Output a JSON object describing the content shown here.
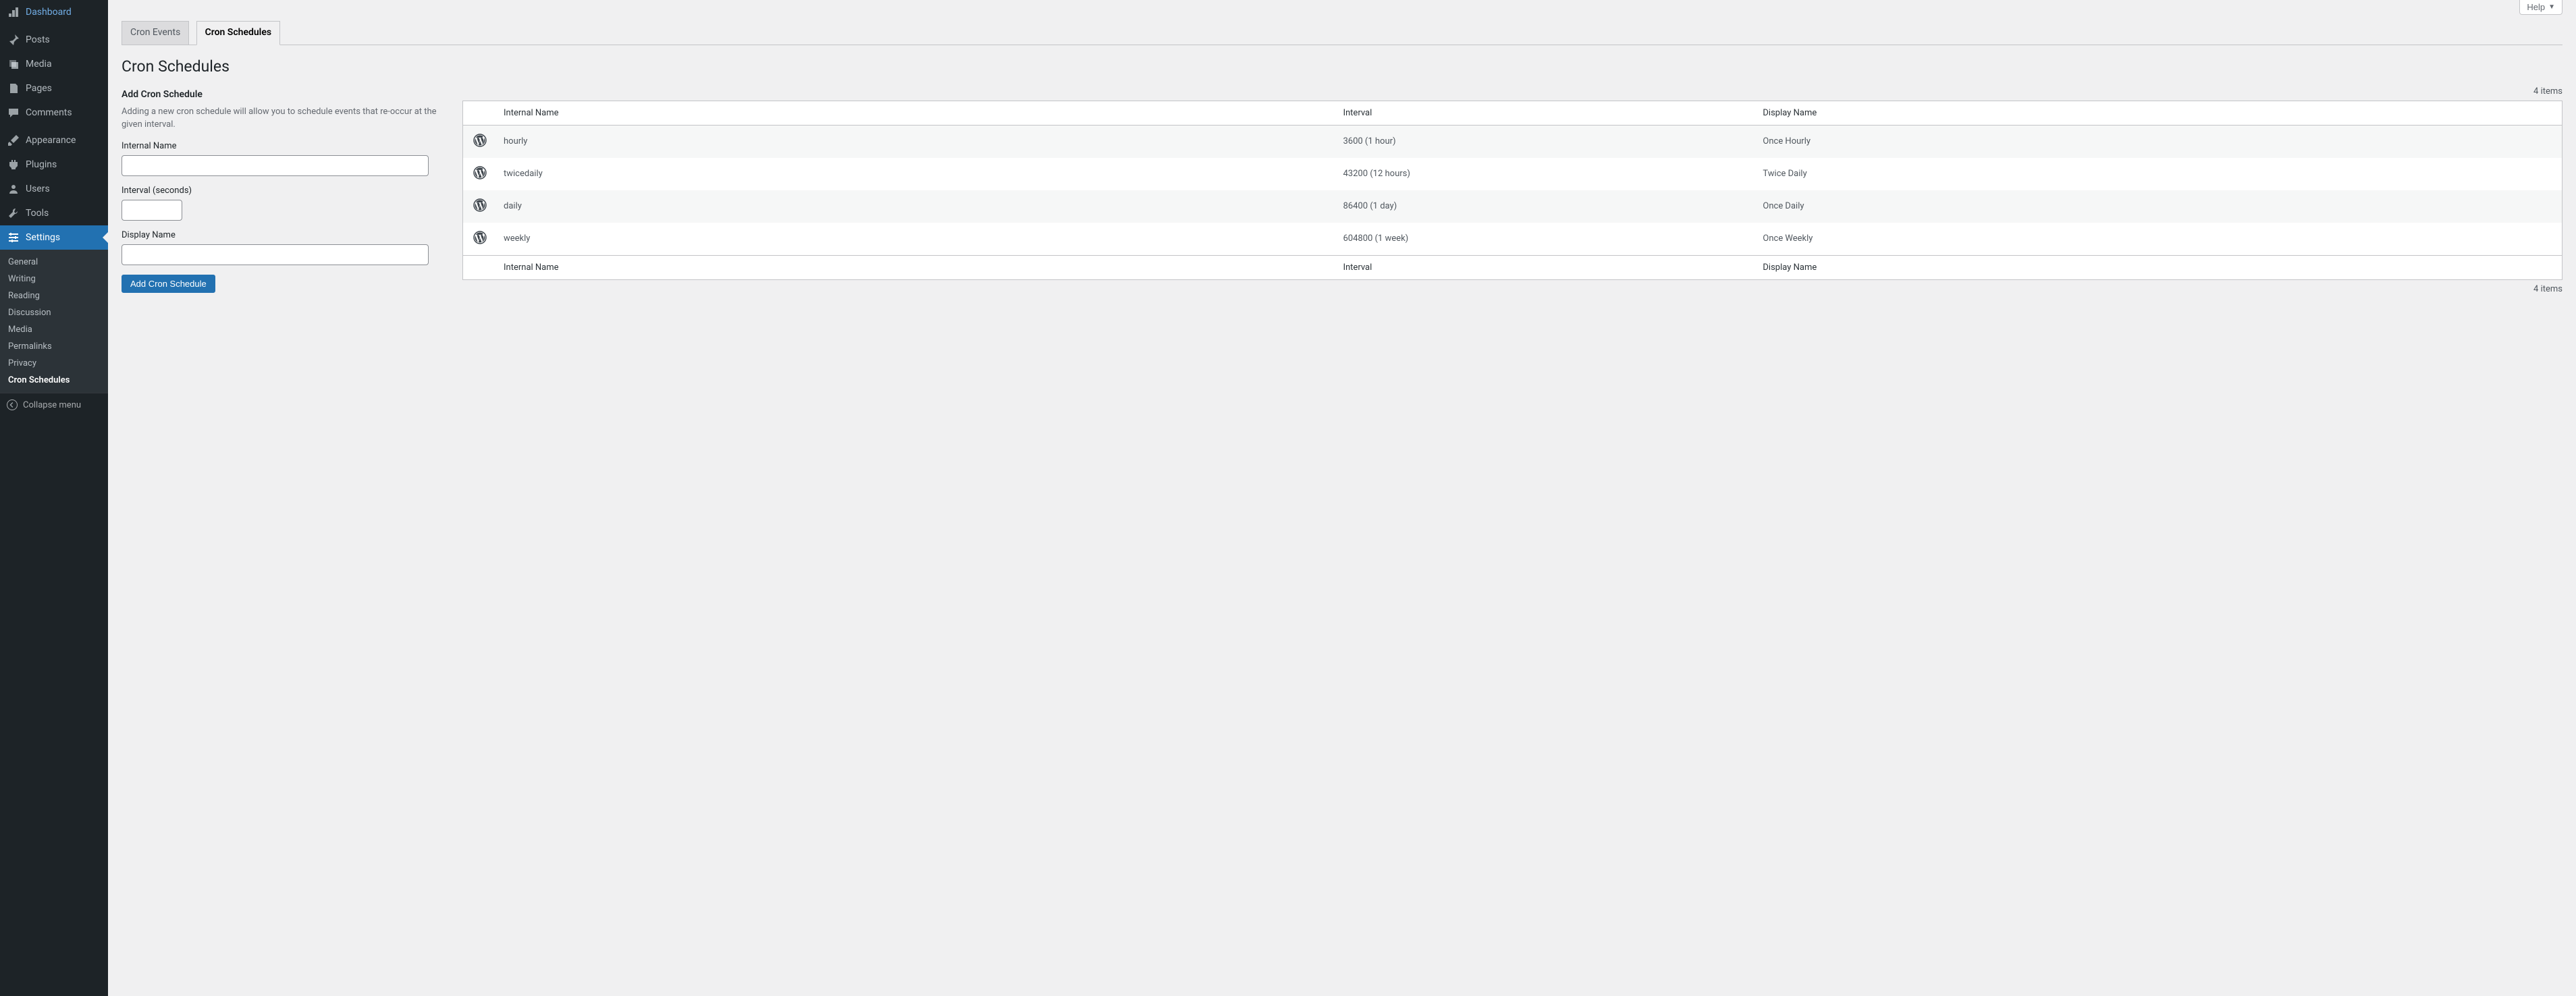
{
  "help_label": "Help",
  "sidebar": {
    "items": [
      {
        "label": "Dashboard"
      },
      {
        "label": "Posts"
      },
      {
        "label": "Media"
      },
      {
        "label": "Pages"
      },
      {
        "label": "Comments"
      },
      {
        "label": "Appearance"
      },
      {
        "label": "Plugins"
      },
      {
        "label": "Users"
      },
      {
        "label": "Tools"
      },
      {
        "label": "Settings"
      }
    ],
    "submenu": [
      {
        "label": "General"
      },
      {
        "label": "Writing"
      },
      {
        "label": "Reading"
      },
      {
        "label": "Discussion"
      },
      {
        "label": "Media"
      },
      {
        "label": "Permalinks"
      },
      {
        "label": "Privacy"
      },
      {
        "label": "Cron Schedules"
      }
    ],
    "collapse_label": "Collapse menu"
  },
  "tabs": [
    {
      "label": "Cron Events"
    },
    {
      "label": "Cron Schedules"
    }
  ],
  "page_title": "Cron Schedules",
  "add_section": {
    "heading": "Add Cron Schedule",
    "description": "Adding a new cron schedule will allow you to schedule events that re-occur at the given interval.",
    "internal_name_label": "Internal Name",
    "interval_label": "Interval (seconds)",
    "display_name_label": "Display Name",
    "submit_label": "Add Cron Schedule",
    "internal_name_value": "",
    "interval_value": "",
    "display_name_value": ""
  },
  "table": {
    "items_count_label": "4 items",
    "columns": {
      "internal_name": "Internal Name",
      "interval": "Interval",
      "display_name": "Display Name"
    },
    "rows": [
      {
        "name": "hourly",
        "interval": "3600 (1 hour)",
        "display": "Once Hourly"
      },
      {
        "name": "twicedaily",
        "interval": "43200 (12 hours)",
        "display": "Twice Daily"
      },
      {
        "name": "daily",
        "interval": "86400 (1 day)",
        "display": "Once Daily"
      },
      {
        "name": "weekly",
        "interval": "604800 (1 week)",
        "display": "Once Weekly"
      }
    ]
  }
}
